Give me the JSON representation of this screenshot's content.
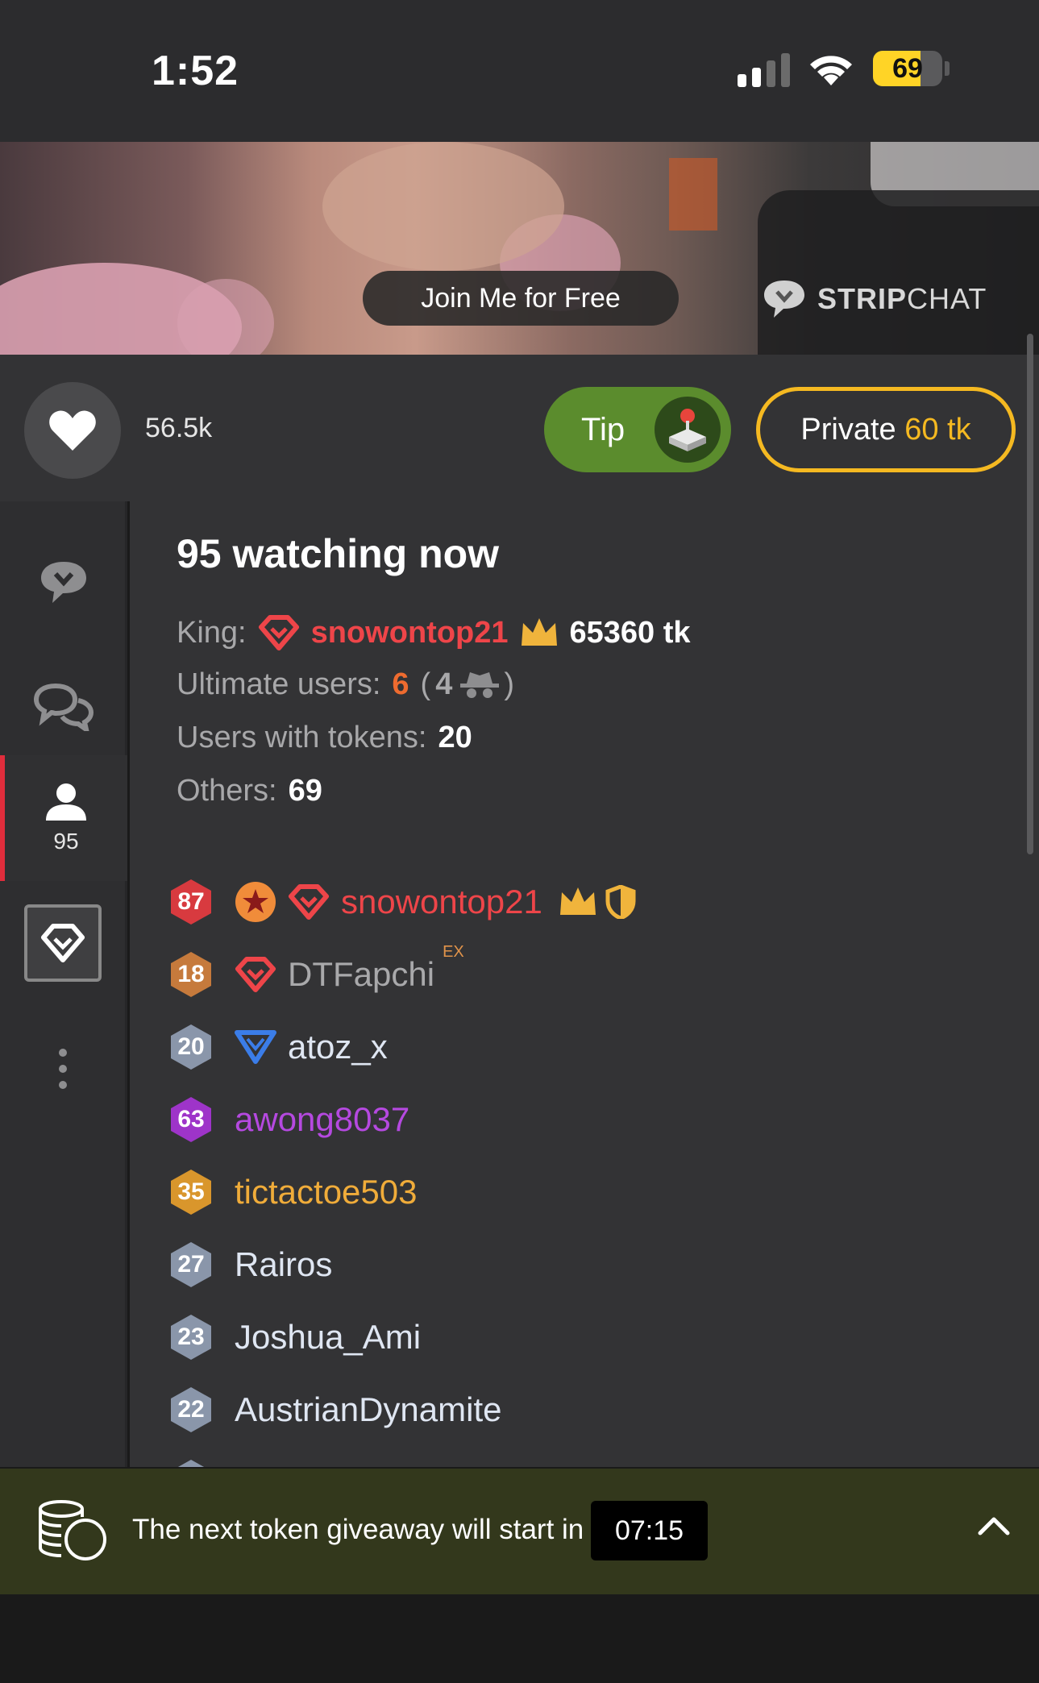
{
  "status_bar": {
    "time": "1:52",
    "battery": "69",
    "battery_fraction": 0.69
  },
  "video": {
    "join_label": "Join Me for Free",
    "logo_bold": "STRIP",
    "logo_light": "CHAT"
  },
  "actions": {
    "like_count": "56.5k",
    "tip_label": "Tip",
    "private_label": "Private",
    "private_price": "60 tk"
  },
  "sidebar": {
    "users_count": "95",
    "icons": [
      "stripchat-chat-icon",
      "chat-bubbles-icon",
      "user-icon",
      "diamond-icon",
      "more-dots-icon"
    ]
  },
  "panel": {
    "watching": "95 watching now",
    "king_label": "King:",
    "king_name": "snowontop21",
    "king_amount": "65360 tk",
    "ultimate_label": "Ultimate users:",
    "ultimate_count": "6",
    "ultimate_open": "(",
    "ultimate_hidden": "4",
    "ultimate_close": ")",
    "tokens_label": "Users with tokens:",
    "tokens_count": "20",
    "others_label": "Others:",
    "others_count": "69"
  },
  "users": [
    {
      "level": "87",
      "name": "snowontop21",
      "color": "#ee4549",
      "badge": "#d83a3f"
    },
    {
      "level": "18",
      "name": "DTFapchi",
      "color": "#a9a9ab",
      "badge": "#c67a3c",
      "tag": "EX"
    },
    {
      "level": "20",
      "name": "atoz_x",
      "color": "#dfe6f2",
      "badge": "#8a96aa"
    },
    {
      "level": "63",
      "name": "awong8037",
      "color": "#b549e0",
      "badge": "#9e34c9"
    },
    {
      "level": "35",
      "name": "tictactoe503",
      "color": "#f0ac3a",
      "badge": "#d9962c"
    },
    {
      "level": "27",
      "name": "Rairos",
      "color": "#dfe6f2",
      "badge": "#8a96aa"
    },
    {
      "level": "23",
      "name": "Joshua_Ami",
      "color": "#dfe6f2",
      "badge": "#8a96aa"
    },
    {
      "level": "22",
      "name": "AustrianDynamite",
      "color": "#dfe6f2",
      "badge": "#8a96aa"
    }
  ],
  "banner": {
    "text": "The next token giveaway will start in",
    "timer": "07:15"
  }
}
